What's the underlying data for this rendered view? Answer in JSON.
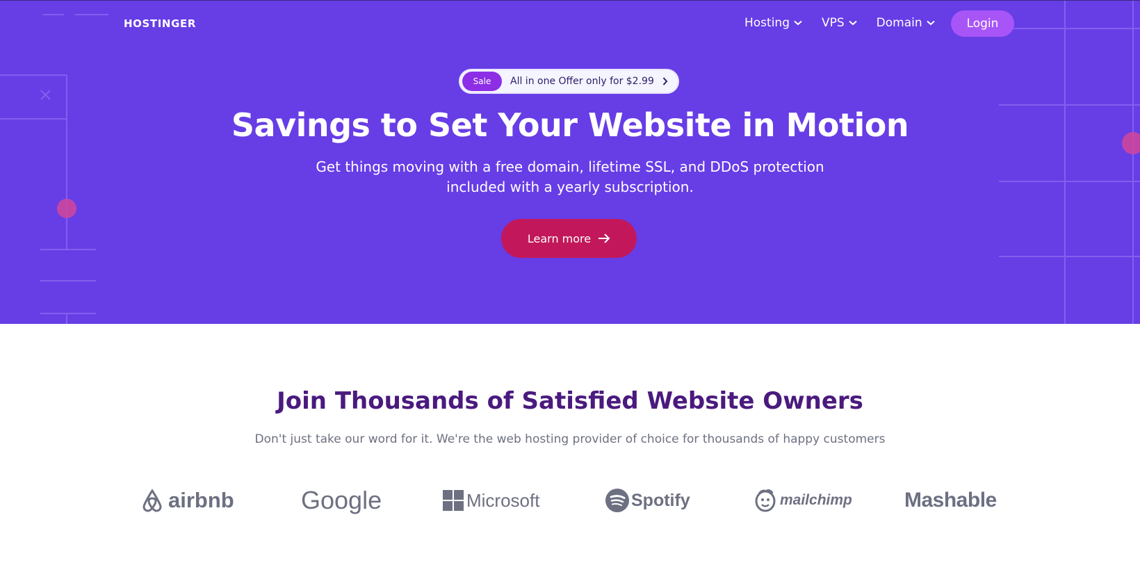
{
  "header": {
    "brand": "HOSTINGER",
    "nav": [
      {
        "label": "Hosting"
      },
      {
        "label": "VPS"
      },
      {
        "label": "Domain"
      }
    ],
    "login_label": "Login"
  },
  "hero": {
    "badge": "Sale",
    "offer": "All in one Offer only for $2.99",
    "title": "Savings to Set Your Website in Motion",
    "subtitle": "Get things moving with a free domain, lifetime SSL, and DDoS protection included with a yearly subscription.",
    "cta_label": "Learn more"
  },
  "trust": {
    "title": "Join Thousands of Satisfied Website Owners",
    "subtitle": "Don't just take our word for it. We're the web hosting provider of choice for thousands of happy customers",
    "logos": [
      {
        "name": "airbnb"
      },
      {
        "name": "Google"
      },
      {
        "name": "Microsoft"
      },
      {
        "name": "Spotify"
      },
      {
        "name": "mailchimp"
      },
      {
        "name": "Mashable"
      }
    ]
  },
  "colors": {
    "hero_bg": "#673de6",
    "cta_bg": "#c2185b",
    "login_bg": "#a855f7",
    "sale_badge_bg": "#8c2ee6",
    "section_title": "#4a1a7e",
    "logo_gray": "#6d7081"
  },
  "icons": {
    "nav_dropdown": "chevron-down-icon",
    "offer": "chevron-right-icon",
    "cta": "arrow-right-icon"
  }
}
